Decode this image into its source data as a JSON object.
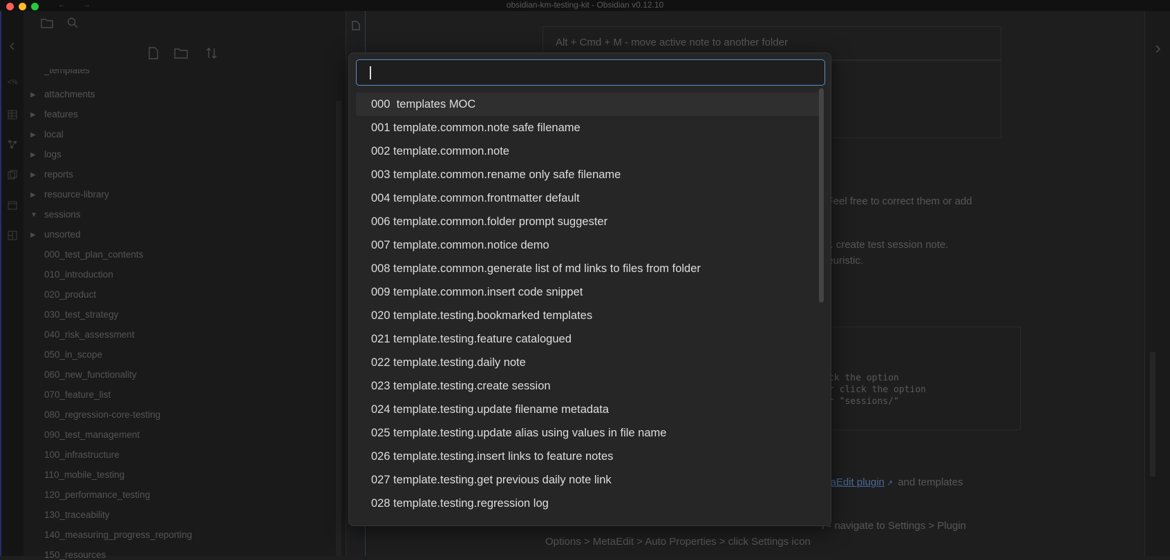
{
  "window": {
    "title": "obsidian-km-testing-kit - Obsidian v0.12.10",
    "back_glyph": "←",
    "forward_glyph": "→"
  },
  "ribbon": {
    "icons": [
      "chevron-left-icon",
      "percent-code-icon",
      "table-icon",
      "graph-icon",
      "copy-icon",
      "calendar-icon",
      "layout-icon"
    ]
  },
  "sidebar": {
    "top_icons": [
      "folder-icon",
      "search-icon"
    ],
    "actions": [
      "new-note-icon",
      "new-folder-icon",
      "sort-icon"
    ],
    "items": [
      {
        "label": "_templates",
        "arrow": ""
      },
      {
        "label": "attachments",
        "arrow": "▶"
      },
      {
        "label": "features",
        "arrow": "▶"
      },
      {
        "label": "local",
        "arrow": "▶"
      },
      {
        "label": "logs",
        "arrow": "▶"
      },
      {
        "label": "reports",
        "arrow": "▶"
      },
      {
        "label": "resource-library",
        "arrow": "▶"
      },
      {
        "label": "sessions",
        "arrow": "▼"
      },
      {
        "label": "unsorted",
        "arrow": "▶"
      },
      {
        "label": "000_test_plan_contents",
        "arrow": ""
      },
      {
        "label": "010_introduction",
        "arrow": ""
      },
      {
        "label": "020_product",
        "arrow": ""
      },
      {
        "label": "030_test_strategy",
        "arrow": ""
      },
      {
        "label": "040_risk_assessment",
        "arrow": ""
      },
      {
        "label": "050_in_scope",
        "arrow": ""
      },
      {
        "label": "060_new_functionality",
        "arrow": ""
      },
      {
        "label": "070_feature_list",
        "arrow": ""
      },
      {
        "label": "080_regression-core-testing",
        "arrow": ""
      },
      {
        "label": "090_test_management",
        "arrow": ""
      },
      {
        "label": "100_infrastructure",
        "arrow": ""
      },
      {
        "label": "110_mobile_testing",
        "arrow": ""
      },
      {
        "label": "120_performance_testing",
        "arrow": ""
      },
      {
        "label": "130_traceability",
        "arrow": ""
      },
      {
        "label": "140_measuring_progress_reporting",
        "arrow": ""
      },
      {
        "label": "150_resources",
        "arrow": ""
      }
    ]
  },
  "editor": {
    "shortcut_text": "Alt + Cmd + M - move active note to another folder",
    "line1": "r. Feel free to correct them or add",
    "line2": ".g. create test session note.",
    "line3": "heuristic.",
    "code1": "ck the option",
    "code2": "r click the option",
    "code3": "r \"sessions/\"",
    "link_text": "etaEdit plugin",
    "after_link": " and templates",
    "line4": "r - navigate to Settings > Plugin",
    "line5": "Options > MetaEdit > Auto Properties > click Settings icon"
  },
  "modal": {
    "input_value": "",
    "suggestions": [
      "000  templates MOC",
      "001 template.common.note safe filename",
      "002 template.common.note",
      "003 template.common.rename only safe filename",
      "004 template.common.frontmatter default",
      "006 template.common.folder prompt suggester",
      "007 template.common.notice demo",
      "008 template.common.generate list of md links to files from folder",
      "009 template.common.insert code snippet",
      "020 template.testing.bookmarked templates",
      "021 template.testing.feature catalogued",
      "022 template.testing.daily note",
      "023 template.testing.create session",
      "024 template.testing.update filename metadata",
      "025 template.testing.update alias using values in file name",
      "026 template.testing.insert links to feature notes",
      "027 template.testing.get previous daily note link",
      "028 template.testing.regression log"
    ]
  }
}
